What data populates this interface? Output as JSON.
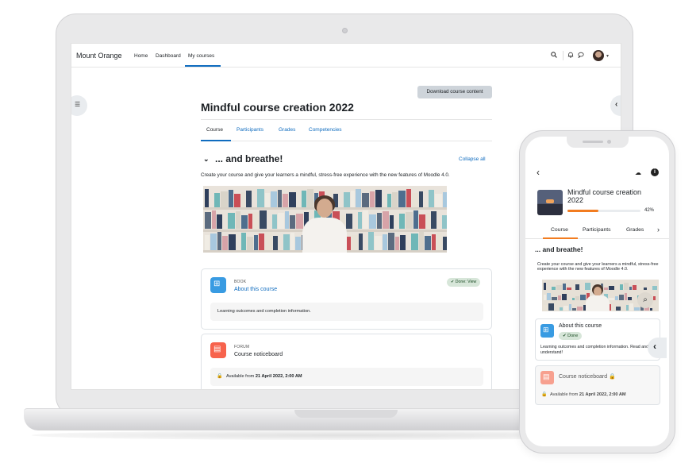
{
  "desktop": {
    "navbar": {
      "brand": "Mount Orange",
      "links": [
        "Home",
        "Dashboard",
        "My courses"
      ],
      "active_link": "My courses",
      "icons": [
        "search-icon",
        "bell-icon",
        "chat-icon",
        "avatar",
        "chevron-down-icon"
      ]
    },
    "download_button": "Download course content",
    "course_title": "Mindful course creation 2022",
    "tabs": [
      "Course",
      "Participants",
      "Grades",
      "Competencies"
    ],
    "active_tab": "Course",
    "section": {
      "title": "... and breathe!",
      "collapse_all": "Collapse all",
      "description": "Create your course and give your learners a mindful, stress-free experience with the new features of Moodle 4.0."
    },
    "activities": [
      {
        "type": "BOOK",
        "name": "About this course",
        "badge": "Done: View",
        "description": "Learning outcomes and completion information.",
        "icon": "book-icon",
        "color": "#399be2"
      },
      {
        "type": "FORUM",
        "name": "Course noticeboard",
        "availability_prefix": "Available from",
        "availability_date": "21 April 2022, 2:00 AM",
        "icon": "forum-icon",
        "color": "#f7634d"
      }
    ]
  },
  "mobile": {
    "course_title": "Mindful course creation 2022",
    "progress_label": "42%",
    "progress_value": 0.42,
    "tabs": [
      "Course",
      "Participants",
      "Grades"
    ],
    "section_title": "... and breathe!",
    "section_description": "Create your course and give your learners a mindful, stress-free experience with the new features of Moodle 4.0.",
    "activities": [
      {
        "name": "About this course",
        "badge": "Done",
        "description": "Learning outcomes and completion information. Read and understand!"
      },
      {
        "name": "Course noticeboard",
        "availability_prefix": "Available from",
        "availability_date": "21 April 2022, 2:00 AM"
      }
    ]
  },
  "colors": {
    "link": "#0f6cbf",
    "accent_orange": "#f27c20",
    "done_bg": "#d7e6d9"
  }
}
